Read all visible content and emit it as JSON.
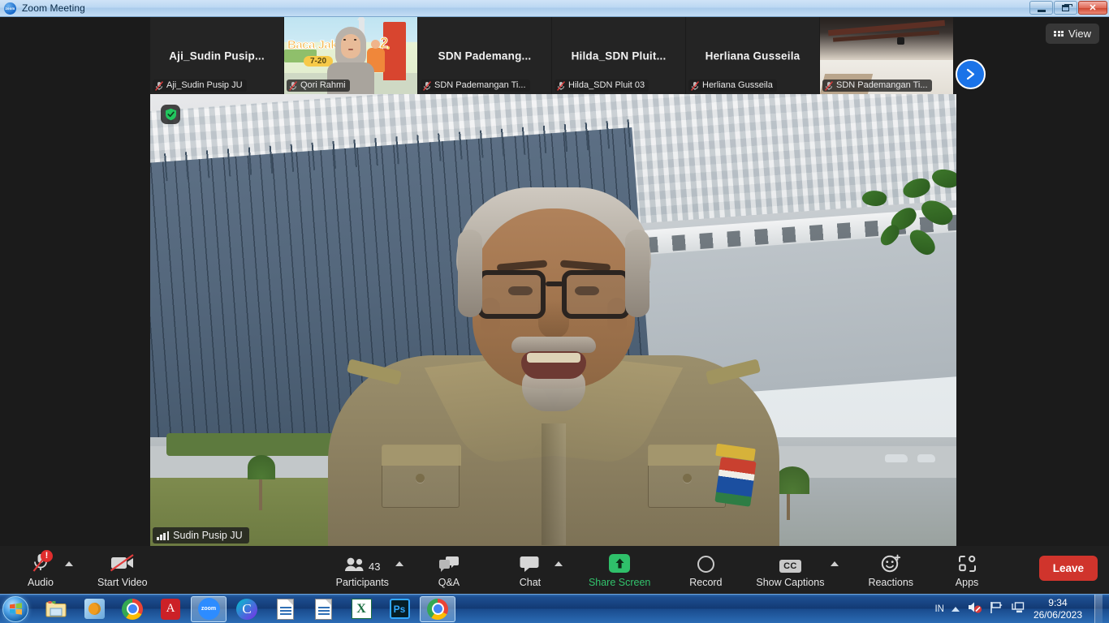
{
  "window": {
    "title": "Zoom Meeting",
    "icon": "zoom-logo-icon",
    "minimize_label": "Minimize",
    "maximize_label": "Restore",
    "close_label": "Close"
  },
  "filmstrip": {
    "view_button": {
      "label": "View",
      "icon": "grid-view-icon"
    },
    "next_button": {
      "label": "Next page",
      "icon": "chevron-right-icon"
    },
    "thumbnails": [
      {
        "display_name": "Aji_Sudin  Pusip...",
        "footer_name": "Aji_Sudin Pusip JU",
        "muted": true,
        "has_video": false
      },
      {
        "display_name": "",
        "footer_name": "Qori Rahmi",
        "muted": true,
        "has_video": true,
        "background_title": "Baca Jak",
        "background_number": "2",
        "background_pill": "7-20"
      },
      {
        "display_name": "SDN  Pademang...",
        "footer_name": "SDN Pademangan Ti...",
        "muted": true,
        "has_video": false
      },
      {
        "display_name": "Hilda_SDN  Pluit...",
        "footer_name": "Hilda_SDN Pluit 03",
        "muted": true,
        "has_video": false
      },
      {
        "display_name": "Herliana Gusseila",
        "footer_name": "Herliana Gusseila",
        "muted": true,
        "has_video": false
      },
      {
        "display_name": "",
        "footer_name": "SDN Pademangan Ti...",
        "muted": true,
        "has_video": true
      }
    ]
  },
  "speaker": {
    "name": "Sudin Pusip JU",
    "encryption_icon": "green-shield-check-icon",
    "audio_icon": "audio-bars-icon"
  },
  "toolbar": {
    "audio": {
      "label": "Audio",
      "icon": "microphone-muted-icon",
      "badge": "!"
    },
    "video": {
      "label": "Start Video",
      "icon": "camera-off-icon"
    },
    "participants": {
      "label": "Participants",
      "icon": "people-icon",
      "count": "43"
    },
    "qanda": {
      "label": "Q&A",
      "icon": "question-answer-icon"
    },
    "chat": {
      "label": "Chat",
      "icon": "chat-bubble-icon"
    },
    "share": {
      "label": "Share Screen",
      "icon": "share-screen-arrow-icon"
    },
    "record": {
      "label": "Record",
      "icon": "record-circle-icon"
    },
    "captions": {
      "label": "Show Captions",
      "icon": "cc-icon"
    },
    "reactions": {
      "label": "Reactions",
      "icon": "smiley-plus-icon"
    },
    "apps": {
      "label": "Apps",
      "icon": "apps-brackets-icon"
    },
    "leave": {
      "label": "Leave"
    }
  },
  "taskbar": {
    "start": {
      "icon": "windows-start-orb-icon"
    },
    "items": [
      {
        "name": "Windows Explorer",
        "icon": "folder-icon",
        "active": false
      },
      {
        "name": "Windows Media Player",
        "icon": "media-player-icon",
        "active": false
      },
      {
        "name": "Google Chrome",
        "icon": "chrome-icon",
        "active": false
      },
      {
        "name": "Adobe Acrobat Reader",
        "icon": "pdf-icon",
        "active": false
      },
      {
        "name": "Zoom",
        "icon": "zoom-icon",
        "active": true
      },
      {
        "name": "Canva",
        "icon": "canva-icon",
        "active": false
      },
      {
        "name": "Document 1",
        "icon": "document-icon",
        "active": false
      },
      {
        "name": "Document 2",
        "icon": "document-icon",
        "active": false
      },
      {
        "name": "Microsoft Excel",
        "icon": "excel-icon",
        "active": false
      },
      {
        "name": "Adobe Photoshop",
        "icon": "photoshop-icon",
        "active": false
      },
      {
        "name": "Google Chrome 2",
        "icon": "chrome-s-icon",
        "active": true
      }
    ],
    "tray": {
      "language": "IN",
      "show_hidden_icons": "show-hidden-icons-icon",
      "volume": "volume-muted-icon",
      "action_center": "flag-icon",
      "network": "network-icon",
      "time": "9:34",
      "date": "26/06/2023"
    }
  },
  "colors": {
    "accent_blue": "#1a73e8",
    "share_green": "#2fc06a",
    "leave_red": "#d0342c",
    "alert_red": "#e02d2d",
    "toolbar_bg": "#1f1f1f",
    "client_bg": "#1b1b1b"
  }
}
